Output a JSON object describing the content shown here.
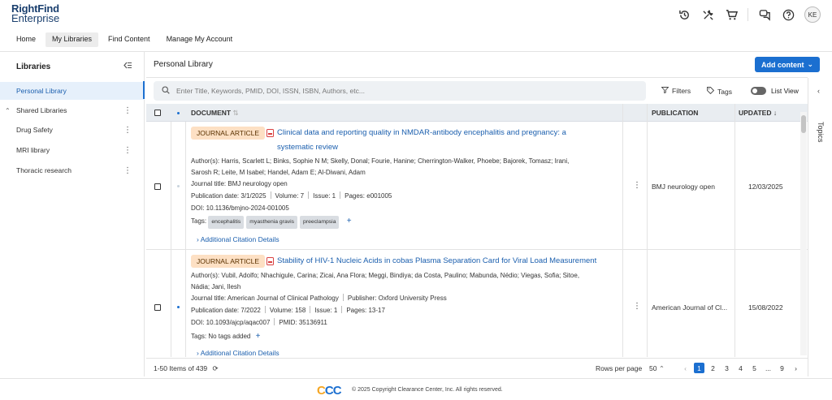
{
  "brand": {
    "line1": "RightFind",
    "line2": "Enterprise"
  },
  "header": {
    "avatar_initials": "KE"
  },
  "nav": {
    "tabs": [
      {
        "label": "Home"
      },
      {
        "label": "My Libraries"
      },
      {
        "label": "Find Content"
      },
      {
        "label": "Manage My Account"
      }
    ]
  },
  "sidebar": {
    "title": "Libraries",
    "items": [
      {
        "label": "Personal Library"
      },
      {
        "label": "Shared Libraries"
      },
      {
        "label": "Drug Safety"
      },
      {
        "label": "MRI library"
      },
      {
        "label": "Thoracic research"
      }
    ]
  },
  "main": {
    "title": "Personal Library",
    "add_content": "Add content",
    "search_placeholder": "Enter Title, Keywords, PMID, DOI, ISSN, ISBN, Authors, etc...",
    "filters_label": "Filters",
    "tags_label": "Tags",
    "list_view_label": "List View"
  },
  "table": {
    "headers": {
      "document": "DOCUMENT",
      "publication": "PUBLICATION",
      "updated": "UPDATED"
    },
    "rows": [
      {
        "type": "JOURNAL ARTICLE",
        "title": "Clinical data and reporting quality in NMDAR-antibody encephalitis and pregnancy: a systematic review",
        "authors_line1": "Author(s): Harris, Scarlett L; Binks, Sophie N M; Skelly, Donal; Fourie, Hanine; Cherrington-Walker, Phoebe; Bajorek, Tomasz; Irani,",
        "authors_line2": "Sarosh R; Leite, M Isabel; Handel, Adam E; Al-Diwani, Adam",
        "journal": "Journal title: BMJ neurology open",
        "pub_date": "Publication date: 3/1/2025",
        "volume": "Volume: 7",
        "issue": "Issue: 1",
        "pages": "Pages: e001005",
        "doi": "DOI: 10.1136/bmjno-2024-001005",
        "tags_label": "Tags:",
        "tags": [
          "encephalitis",
          "myasthenia gravis",
          "preeclampsia"
        ],
        "additional": "Additional Citation Details",
        "publication": "BMJ neurology open",
        "updated": "12/03/2025"
      },
      {
        "type": "JOURNAL ARTICLE",
        "title": "Stability of HIV-1 Nucleic Acids in cobas Plasma Separation Card for Viral Load Measurement",
        "authors_line1": "Author(s): Vubil, Adolfo; Nhachigule, Carina; Zicai, Ana Flora; Meggi, Bindiya; da Costa, Paulino; Mabunda, Nédio; Viegas, Sofia; Sitoe,",
        "authors_line2": "Nádia; Jani, Ilesh",
        "journal": "Journal title: American Journal of Clinical Pathology",
        "publisher": "Publisher: Oxford University Press",
        "pub_date": "Publication date: 7/2022",
        "volume": "Volume: 158",
        "issue": "Issue: 1",
        "pages": "Pages: 13-17",
        "doi": "DOI: 10.1093/ajcp/aqac007",
        "pmid": "PMID: 35136911",
        "tags_text": "Tags: No tags added",
        "additional": "Additional Citation Details",
        "publication": "American Journal of Cl...",
        "updated": "15/08/2022"
      }
    ]
  },
  "pager": {
    "items_text": "1-50 Items of 439",
    "rows_per_page_label": "Rows per page",
    "rows_per_page_value": "50",
    "pages": [
      "1",
      "2",
      "3",
      "4",
      "5",
      "...",
      "9"
    ]
  },
  "right_rail": {
    "label": "Topics"
  },
  "footer": {
    "logo": "CCC",
    "copyright": "© 2025 Copyright Clearance Center, Inc. All rights reserved."
  }
}
